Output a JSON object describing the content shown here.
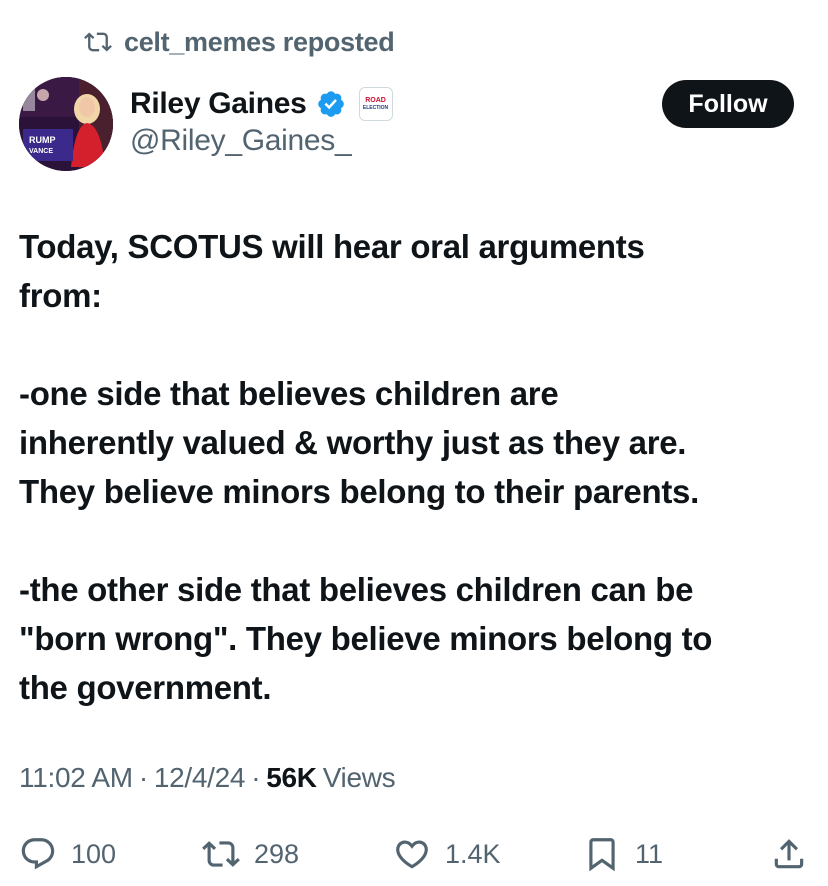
{
  "repost": {
    "icon": "repost-icon",
    "text": "celt_memes reposted"
  },
  "author": {
    "avatar_icon": "avatar",
    "display_name": "Riley Gaines",
    "verified_icon": "verified-badge-icon",
    "affiliate_line1": "ROAD",
    "affiliate_line2": "ELECTION",
    "handle": "@Riley_Gaines_",
    "avatar_sign_line1": "RUMP",
    "avatar_sign_line2": "VANCE"
  },
  "follow_button": {
    "label": "Follow"
  },
  "tweet": {
    "text": "Today, SCOTUS will hear oral arguments\nfrom:\n\n-one side that believes children are\ninherently valued & worthy just as they are.\nThey believe minors belong to their parents.\n\n-the other side that believes children can be\n\"born wrong\". They believe minors belong to\nthe government."
  },
  "meta": {
    "time": "11:02 AM",
    "separator": "·",
    "date": "12/4/24",
    "views_count": "56K",
    "views_label": "Views"
  },
  "actions": {
    "reply": {
      "icon": "reply-icon",
      "count": "100"
    },
    "repost": {
      "icon": "repost-icon",
      "count": "298"
    },
    "like": {
      "icon": "like-icon",
      "count": "1.4K"
    },
    "bookmark": {
      "icon": "bookmark-icon",
      "count": "11"
    },
    "share": {
      "icon": "share-icon"
    }
  },
  "colors": {
    "verified_blue": "#1d9bf0",
    "text_primary": "#0f1419",
    "text_secondary": "#536471",
    "button_bg": "#0f1419"
  }
}
